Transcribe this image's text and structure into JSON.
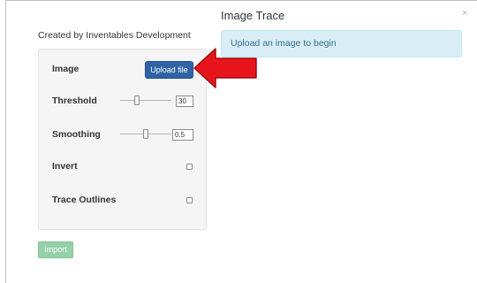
{
  "dialog": {
    "title": "Image Trace",
    "close_label": "×",
    "created_by": "Created by Inventables Development"
  },
  "settings": {
    "image": {
      "label": "Image",
      "button_label": "Upload file"
    },
    "threshold": {
      "label": "Threshold",
      "value": "30",
      "slider_fraction": 0.3
    },
    "smoothing": {
      "label": "Smoothing",
      "value": "0.5",
      "slider_fraction": 0.5
    },
    "invert": {
      "label": "Invert",
      "checked": false
    },
    "trace_outlines": {
      "label": "Trace Outlines",
      "checked": false
    }
  },
  "import_button": {
    "label": "Import"
  },
  "preview": {
    "message": "Upload an image to begin"
  },
  "colors": {
    "upload_button": "#2f63a5",
    "import_button": "#94d1a8",
    "alert_bg": "#d9edf7",
    "alert_text": "#31708f",
    "annotation_arrow": "#e8141b"
  },
  "icons": {
    "close": "close-icon",
    "annotation": "red-arrow-icon"
  }
}
